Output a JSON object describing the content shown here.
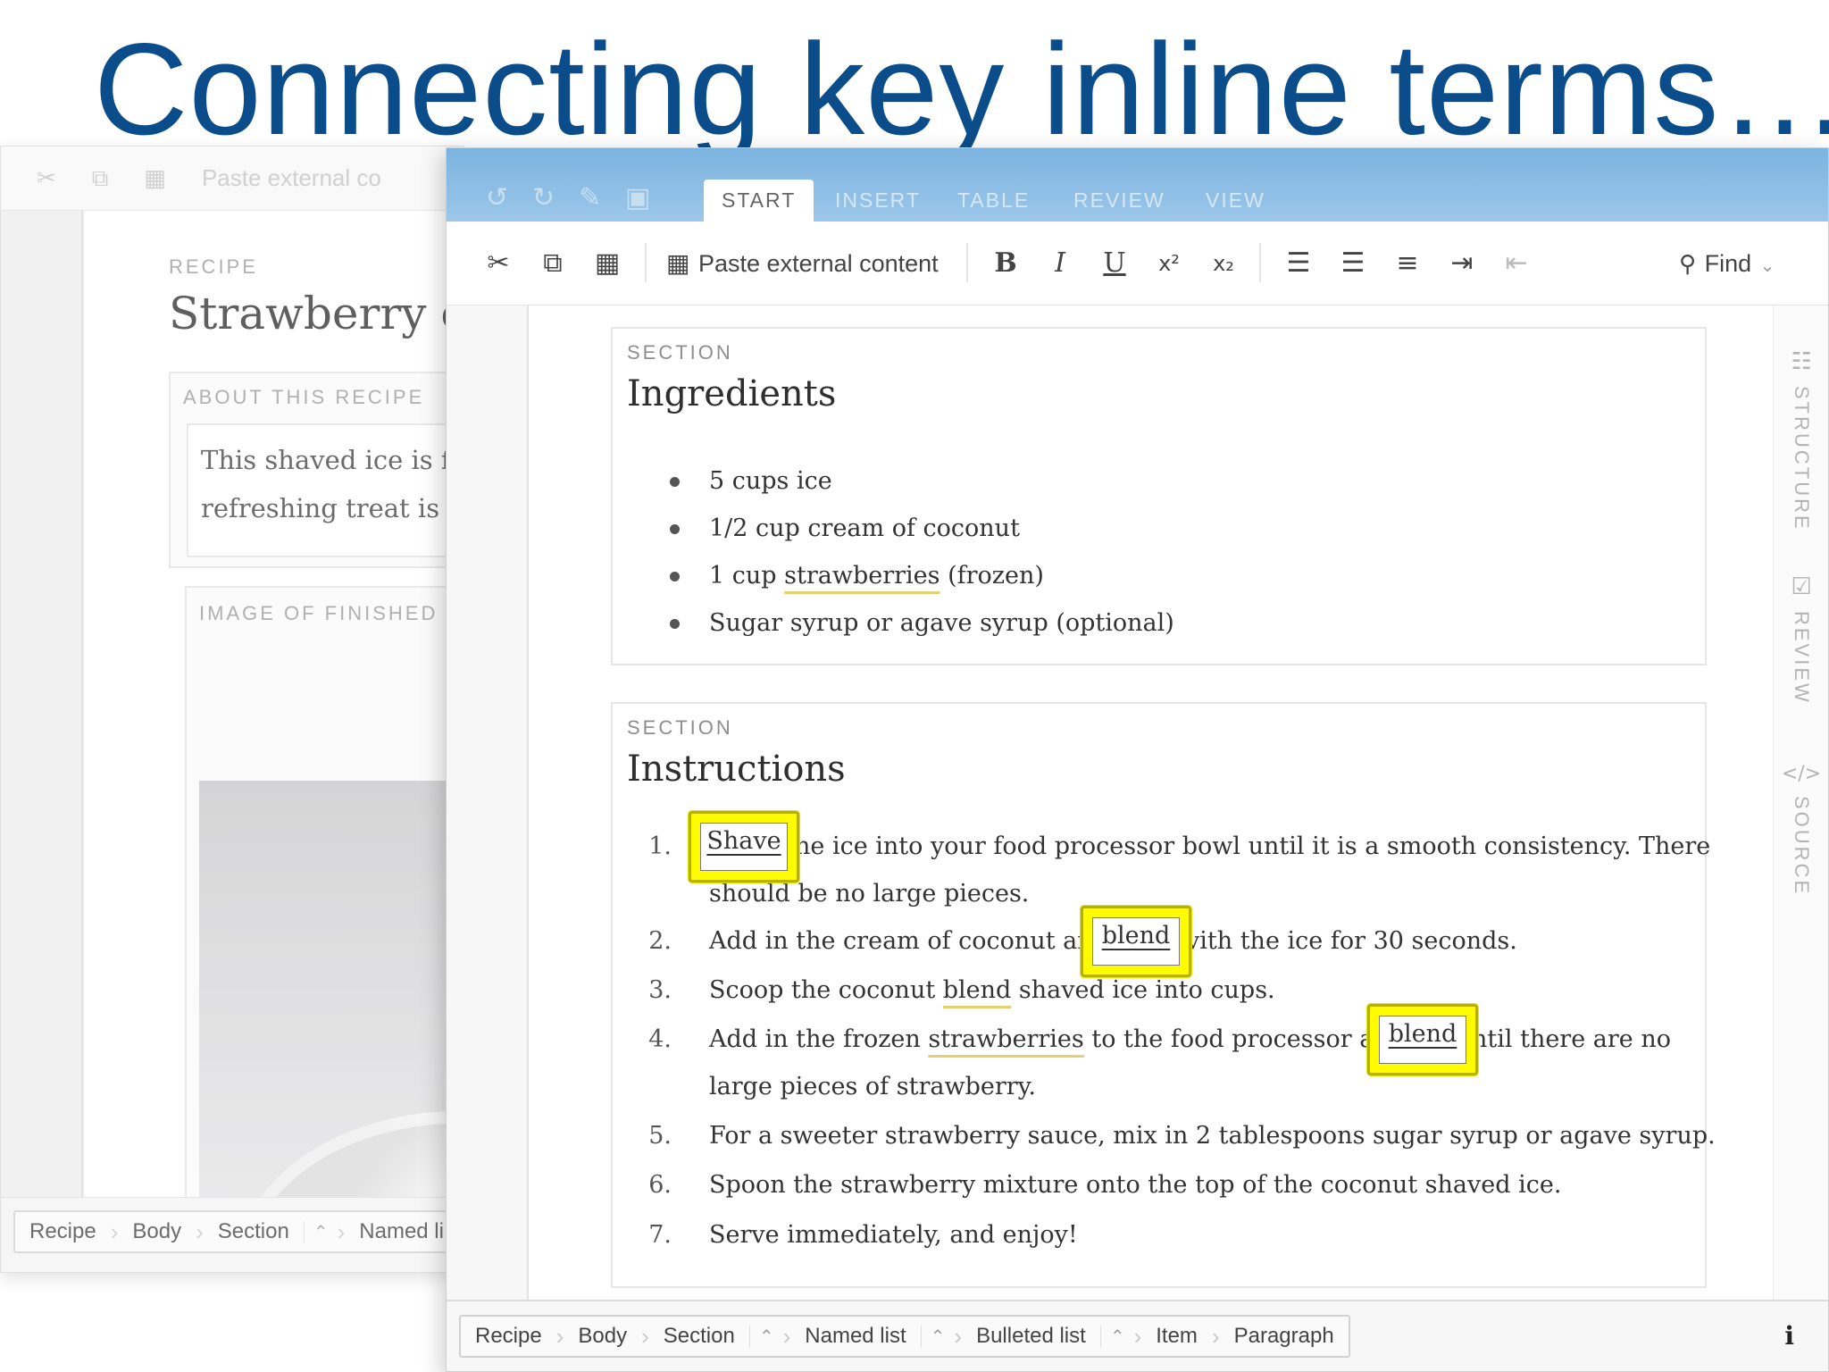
{
  "slide": {
    "title": "Connecting key inline terms…"
  },
  "background_window": {
    "toolbar_paste": "Paste external co",
    "recipe_label": "RECIPE",
    "recipe_title": "Strawberry co",
    "about_label": "ABOUT THIS RECIPE",
    "about_lines": [
      "This shaved ice is fla",
      "refreshing treat is su"
    ],
    "image_label": "IMAGE OF FINISHED D",
    "breadcrumbs": [
      "Recipe",
      "Body",
      "Section",
      "Named li"
    ]
  },
  "editor": {
    "quick_icons": [
      "undo-icon",
      "redo-icon",
      "eraser-icon",
      "save-icon"
    ],
    "tabs": [
      "START",
      "INSERT",
      "TABLE",
      "REVIEW",
      "VIEW"
    ],
    "active_tab": "START",
    "toolbar": {
      "paste_label": "Paste external content",
      "find_label": "Find",
      "bold": "B",
      "italic": "I",
      "underline": "U",
      "superscript": "x²",
      "subscript": "x₂"
    },
    "side_tabs": [
      "STRUCTURE",
      "REVIEW",
      "SOURCE"
    ],
    "ingredients": {
      "label": "SECTION",
      "title": "Ingredients",
      "items": [
        {
          "before": "5 cups ice",
          "term": "",
          "after": ""
        },
        {
          "before": "1/2 cup cream of coconut",
          "term": "",
          "after": ""
        },
        {
          "before": "1 cup ",
          "term": "strawberries",
          "after": " (frozen)"
        },
        {
          "before": "Sugar syrup or agave syrup (optional)",
          "term": "",
          "after": ""
        }
      ]
    },
    "instructions": {
      "label": "SECTION",
      "title": "Instructions",
      "numbers": [
        "1.",
        "2.",
        "3.",
        "4.",
        "5.",
        "6.",
        "7."
      ],
      "step1_rest": "he ice into your food processor bowl until it is a smooth consistency. There",
      "step1_line2": "should be no large pieces.",
      "step2_before": "Add in the cream of coconut an",
      "step2_after": "vith the ice for 30 seconds.",
      "step3_before": "Scoop the coconut ",
      "step3_term": "blend",
      "step3_after": " shaved ice into cups.",
      "step4_before": "Add in the frozen ",
      "step4_term": "strawberries",
      "step4_mid": " to the food processor an",
      "step4_after": "ntil there are no",
      "step4_line2": "large pieces of strawberry.",
      "step5": "For a sweeter strawberry sauce, mix in 2 tablespoons sugar syrup or agave syrup.",
      "step6": "Spoon the strawberry mixture onto the top of the coconut shaved ice.",
      "step7": "Serve immediately, and enjoy!",
      "highlighted_terms": [
        "Shave",
        "blend",
        "blend"
      ]
    },
    "breadcrumbs": [
      "Recipe",
      "Body",
      "Section",
      "Named list",
      "Bulleted list",
      "Item",
      "Paragraph"
    ],
    "info_label": "i"
  },
  "colors": {
    "title": "#0b4d8a",
    "tabbar": "#8bbde6",
    "highlight": "#fffb00",
    "term_underline": "#e5d070"
  }
}
